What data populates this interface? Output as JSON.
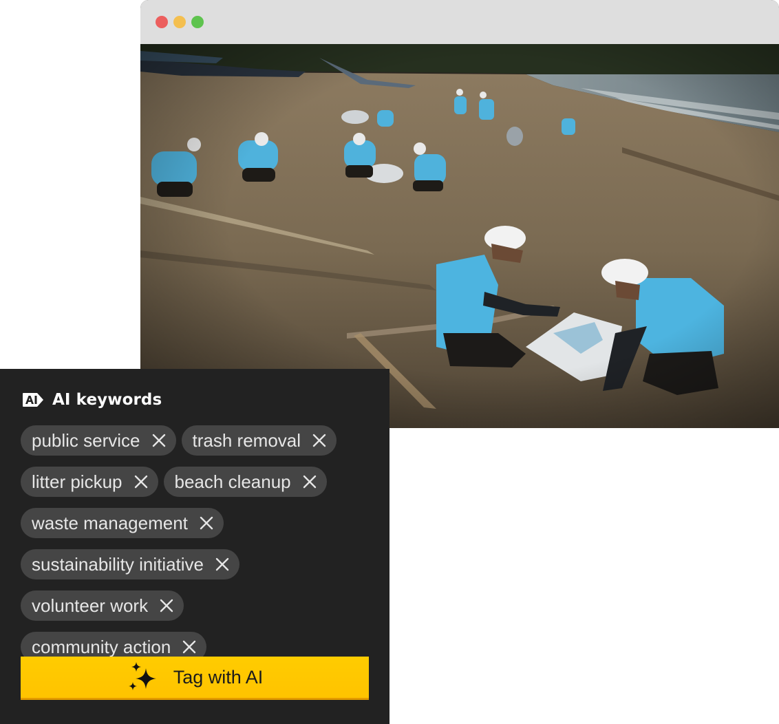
{
  "panel": {
    "title": "AI keywords",
    "keywords": [
      {
        "label": "public service"
      },
      {
        "label": "trash removal"
      },
      {
        "label": "litter pickup"
      },
      {
        "label": "beach cleanup"
      },
      {
        "label": "waste management"
      },
      {
        "label": "sustainability initiative"
      },
      {
        "label": "volunteer work"
      },
      {
        "label": "community action"
      }
    ],
    "tag_button_label": "Tag with AI"
  },
  "colors": {
    "panel_bg": "#222222",
    "chip_bg": "#454545",
    "accent": "#ffc300",
    "titlebar": "#dedede"
  },
  "icons": {
    "header": "ai-badge-icon",
    "remove": "close-icon",
    "button": "sparkle-icon"
  }
}
